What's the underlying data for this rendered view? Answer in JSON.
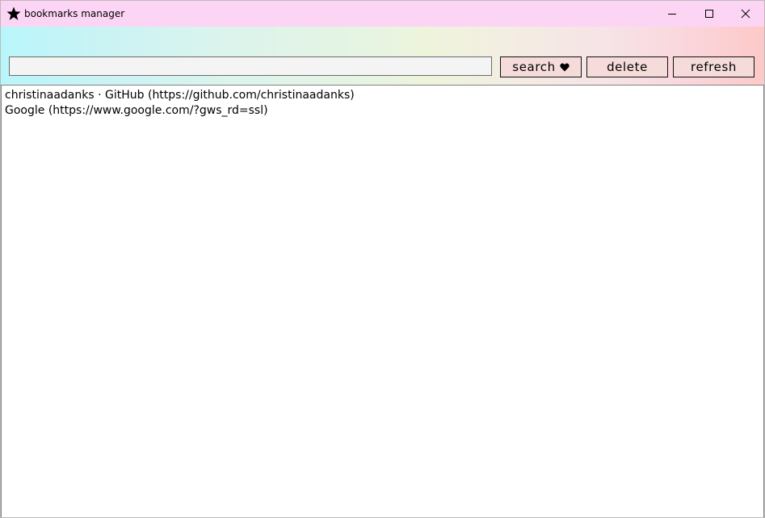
{
  "window": {
    "title": "bookmarks manager",
    "icon": "star-icon",
    "controls": [
      "minimize-icon",
      "maximize-icon",
      "close-icon"
    ]
  },
  "toolbar": {
    "search_value": "",
    "search_placeholder": "",
    "search_label": "search",
    "search_icon": "heart-icon",
    "delete_label": "delete",
    "refresh_label": "refresh"
  },
  "bookmarks": [
    "christinaadanks · GitHub (https://github.com/christinaadanks)",
    "Google (https://www.google.com/?gws_rd=ssl)"
  ],
  "colors": {
    "titlebar": "#fdd5f4",
    "button_bg": "#f5dcda",
    "gradient_start": "#b8f6fb",
    "gradient_end": "#fcc9c7"
  }
}
